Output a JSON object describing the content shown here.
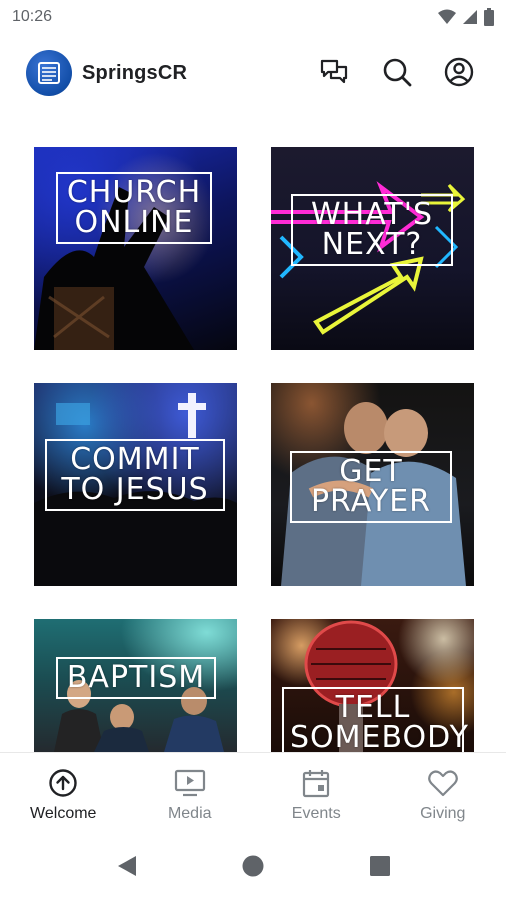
{
  "status_bar": {
    "time": "10:26"
  },
  "app": {
    "title": "SpringsCR"
  },
  "tiles": [
    {
      "label": "CHURCH\nONLINE"
    },
    {
      "label": "WHAT'S\nNEXT?"
    },
    {
      "label": "COMMIT\nTO JESUS"
    },
    {
      "label": "GET\nPRAYER"
    },
    {
      "label": "BAPTISM"
    },
    {
      "label": "TELL\nSOMEBODY"
    }
  ],
  "bottom_nav": [
    {
      "label": "Welcome",
      "icon": "arrow-up-circle-icon",
      "active": true
    },
    {
      "label": "Media",
      "icon": "tv-play-icon",
      "active": false
    },
    {
      "label": "Events",
      "icon": "calendar-icon",
      "active": false
    },
    {
      "label": "Giving",
      "icon": "heart-icon",
      "active": false
    }
  ],
  "colors": {
    "accent": "#124ea8",
    "text": "#202124",
    "inactive": "#80868b"
  }
}
